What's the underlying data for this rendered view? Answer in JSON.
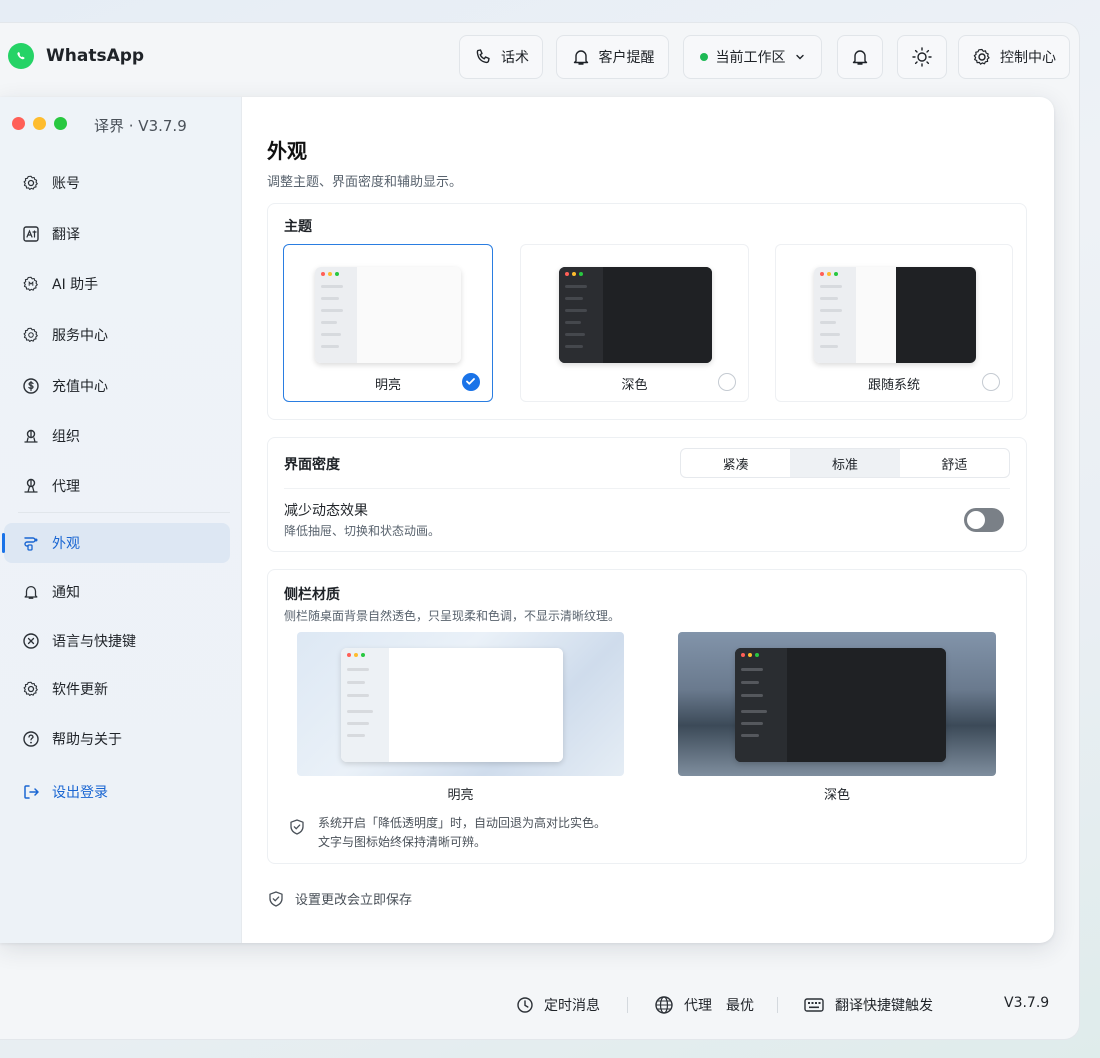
{
  "app": {
    "name": "WhatsApp"
  },
  "topbar": {
    "scripts": "话术",
    "reminders": "客户提醒",
    "workspace": "当前工作区",
    "control_center": "控制中心"
  },
  "window": {
    "title": "译界 · V3.7.9"
  },
  "sidebar": {
    "items": [
      {
        "label": "账号",
        "icon": "gear-icon"
      },
      {
        "label": "翻译",
        "icon": "translate-icon"
      },
      {
        "label": "AI 助手",
        "icon": "ai-gear-icon"
      },
      {
        "label": "服务中心",
        "icon": "service-icon"
      },
      {
        "label": "充值中心",
        "icon": "dollar-icon"
      },
      {
        "label": "组织",
        "icon": "org-icon"
      },
      {
        "label": "代理",
        "icon": "proxy-icon"
      },
      {
        "label": "外观",
        "icon": "palette-icon",
        "active": true
      },
      {
        "label": "通知",
        "icon": "bell-icon"
      },
      {
        "label": "语言与快捷键",
        "icon": "close-circle-icon"
      },
      {
        "label": "软件更新",
        "icon": "gear-icon"
      },
      {
        "label": "帮助与关于",
        "icon": "help-icon"
      }
    ],
    "logout": "设出登录"
  },
  "appearance": {
    "title": "外观",
    "subtitle": "调整主题、界面密度和辅助显示。",
    "theme": {
      "title": "主题",
      "options": [
        {
          "label": "明亮",
          "selected": true
        },
        {
          "label": "深色",
          "selected": false
        },
        {
          "label": "跟随系统",
          "selected": false
        }
      ]
    },
    "density": {
      "title": "界面密度",
      "options": [
        "紧凑",
        "标准",
        "舒适"
      ],
      "selected": "标准"
    },
    "motion": {
      "title": "减少动态效果",
      "desc": "降低抽屉、切换和状态动画。",
      "enabled": false
    },
    "material": {
      "title": "侧栏材质",
      "desc": "侧栏随桌面背景自然透色，只呈现柔和色调，不显示清晰纹理。",
      "light_label": "明亮",
      "dark_label": "深色",
      "note_line1": "系统开启「降低透明度」时，自动回退为高对比实色。",
      "note_line2": "文字与图标始终保持清晰可辨。"
    },
    "save_note": "设置更改会立即保存"
  },
  "statusbar": {
    "scheduled": "定时消息",
    "proxy": "代理",
    "proxy_value": "最优",
    "shortcut": "翻译快捷键触发",
    "version": "V3.7.9"
  },
  "colors": {
    "accent": "#1a73e8",
    "whatsapp": "#25d366",
    "online": "#1db954",
    "traffic_red": "#ff5f57",
    "traffic_yellow": "#febc2e",
    "traffic_green": "#28c840"
  }
}
